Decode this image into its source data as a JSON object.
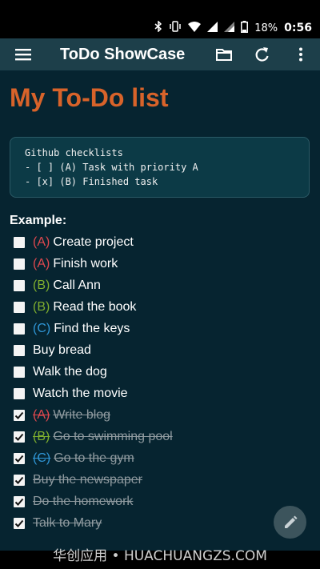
{
  "status": {
    "icons": [
      "bluetooth-icon",
      "vibrate-icon",
      "wifi-icon",
      "signal-icon",
      "signal-icon",
      "battery-icon"
    ],
    "battery": "18%",
    "time": "0:56"
  },
  "appbar": {
    "title": "ToDo ShowCase",
    "actions": [
      "folder-icon",
      "refresh-icon",
      "more-vert-icon"
    ]
  },
  "main": {
    "title": "My To-Do list",
    "code_lines": [
      "Github checklists",
      "- [ ] (A) Task with priority A",
      "- [x] (B) Finished task"
    ],
    "example_label": "Example:",
    "tasks": [
      {
        "priority": "(A)",
        "text": "Create project",
        "done": false
      },
      {
        "priority": "(A)",
        "text": "Finish work",
        "done": false
      },
      {
        "priority": "(B)",
        "text": "Call Ann",
        "done": false
      },
      {
        "priority": "(B)",
        "text": "Read the book",
        "done": false
      },
      {
        "priority": "(C)",
        "text": "Find the keys",
        "done": false
      },
      {
        "priority": "",
        "text": "Buy bread",
        "done": false
      },
      {
        "priority": "",
        "text": "Walk the dog",
        "done": false
      },
      {
        "priority": "",
        "text": "Watch the movie",
        "done": false
      },
      {
        "priority": "(A)",
        "text": "Write blog",
        "done": true
      },
      {
        "priority": "(B)",
        "text": "Go to swimming pool",
        "done": true
      },
      {
        "priority": "(C)",
        "text": "Go to the gym",
        "done": true
      },
      {
        "priority": "",
        "text": "Buy the newspaper",
        "done": true
      },
      {
        "priority": "",
        "text": "Do the homework",
        "done": true
      },
      {
        "priority": "",
        "text": "Talk to Mary",
        "done": true
      }
    ]
  },
  "colors": {
    "priority_A": "#e0484e",
    "priority_B": "#7fae2e",
    "priority_C": "#2f96d6",
    "title": "#d8632a"
  },
  "watermark": "华创应用 • HUACHUANGZS.COM"
}
